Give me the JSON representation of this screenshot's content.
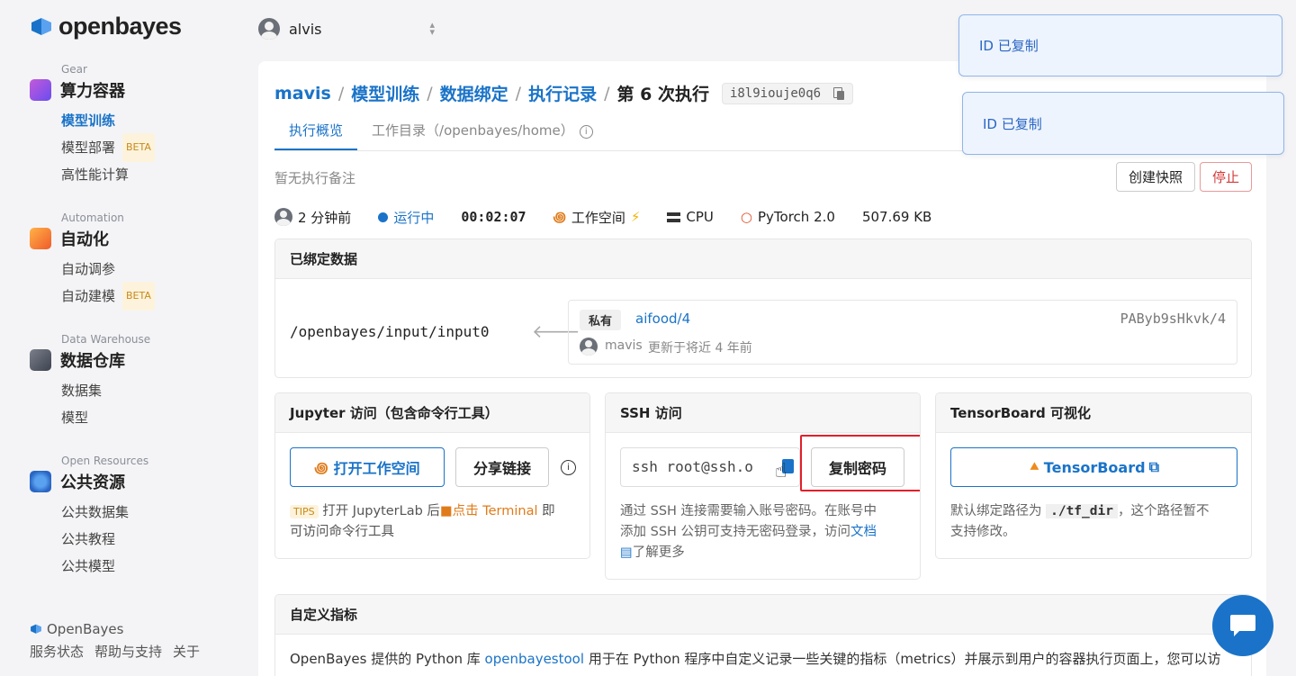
{
  "brand": {
    "name": "openbayes"
  },
  "user": {
    "name": "alvis"
  },
  "sidebar": {
    "sections": [
      {
        "sub": "Gear",
        "title": "算力容器",
        "items": [
          {
            "label": "模型训练",
            "active": true
          },
          {
            "label": "模型部署",
            "beta": "BETA"
          },
          {
            "label": "高性能计算"
          }
        ]
      },
      {
        "sub": "Automation",
        "title": "自动化",
        "items": [
          {
            "label": "自动调参"
          },
          {
            "label": "自动建模",
            "beta": "BETA"
          }
        ]
      },
      {
        "sub": "Data Warehouse",
        "title": "数据仓库",
        "items": [
          {
            "label": "数据集"
          },
          {
            "label": "模型"
          }
        ]
      },
      {
        "sub": "Open Resources",
        "title": "公共资源",
        "items": [
          {
            "label": "公共数据集"
          },
          {
            "label": "公共教程"
          },
          {
            "label": "公共模型"
          }
        ]
      }
    ],
    "footer_brand": "OpenBayes",
    "footer_links": [
      "服务状态",
      "帮助与支持",
      "关于"
    ]
  },
  "breadcrumb": {
    "items": [
      "mavis",
      "模型训练",
      "数据绑定",
      "执行记录"
    ],
    "current": "第 6 次执行",
    "id": "i8l9iouje0q6"
  },
  "tabs": [
    {
      "label": "执行概览",
      "active": true
    },
    {
      "label": "工作目录（/openbayes/home）"
    }
  ],
  "note": "暂无执行备注",
  "actions": {
    "snapshot": "创建快照",
    "stop": "停止"
  },
  "meta": {
    "time": "2 分钟前",
    "status": "运行中",
    "duration": "00:02:07",
    "workspace": "工作空间",
    "resource": "CPU",
    "framework": "PyTorch 2.0",
    "size": "507.69 KB"
  },
  "bound": {
    "title": "已绑定数据",
    "path": "/openbayes/input/input0",
    "tag": "私有",
    "dataset": "aifood/4",
    "version": "PAByb9sHkvk/4",
    "owner": "mavis",
    "updated": "更新于将近 4 年前"
  },
  "jupyter": {
    "title": "Jupyter 访问（包含命令行工具）",
    "open": "打开工作空间",
    "share": "分享链接",
    "tips": "TIPS",
    "tip1": "打开 JupyterLab 后",
    "tip_link": "点击 Terminal",
    "tip2": "即",
    "tip3": "可访问命令行工具"
  },
  "ssh": {
    "title": "SSH 访问",
    "command": "ssh root@ssh.o",
    "copy": "复制密码",
    "desc1": "通过 SSH 连接需要输入账号密码。在账号中",
    "desc2": "添加 SSH 公钥可支持无密码登录，访问",
    "doc": "文档",
    "desc3": "了解更多"
  },
  "tensorboard": {
    "title": "TensorBoard 可视化",
    "button": "TensorBoard",
    "desc1": "默认绑定路径为",
    "path": "./tf_dir",
    "desc2": "，这个路径暂不",
    "desc3": "支持修改。"
  },
  "metrics": {
    "title": "自定义指标",
    "text1": "OpenBayes 提供的 Python 库",
    "lib": "openbayestool",
    "text2": "用于在 Python 程序中自定义记录一些关键的指标（metrics）并展示到用户的容器执行页面上，您可以访"
  },
  "toasts": [
    "ID 已复制",
    "ID 已复制"
  ],
  "colors": {
    "accent": "#1a73c8",
    "stop": "#d23a3a",
    "highlight": "#e0202a",
    "tip": "#e07b1a"
  }
}
